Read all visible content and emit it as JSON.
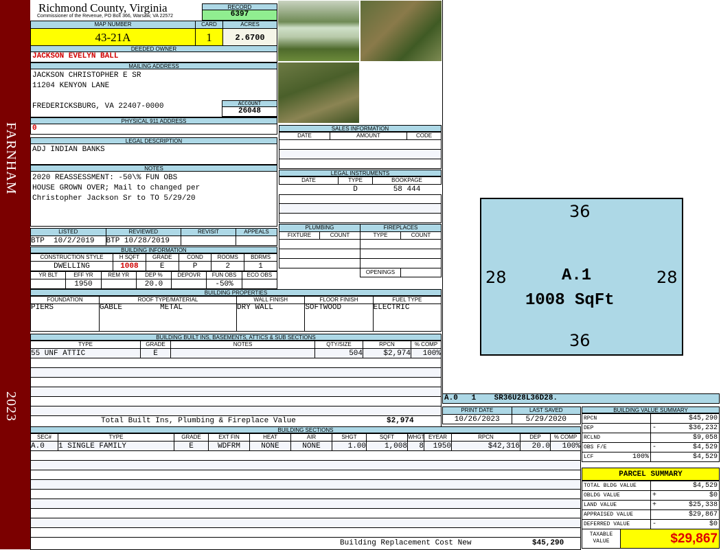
{
  "side": {
    "district": "FARNHAM",
    "year": "2023"
  },
  "header": {
    "county": "Richmond County, Virginia",
    "office": "Commissioner of the Revenue, PO Box 366, Warsaw, VA 22572",
    "record_label": "RECORD",
    "record": "6397"
  },
  "ids": {
    "map_label": "MAP NUMBER",
    "map": "43-21A",
    "card_label": "CARD",
    "card": "1",
    "acres_label": "ACRES",
    "acres": "2.6700"
  },
  "owner": {
    "label": "DEEDED OWNER",
    "name": "JACKSON EVELYN BALL"
  },
  "mailing": {
    "label": "MAILING ADDRESS",
    "line1": "JACKSON CHRISTOPHER E SR",
    "line2": "11204 KENYON LANE",
    "line3": "FREDERICKSBURG, VA 22407-0000",
    "account_label": "ACCOUNT",
    "account": "26048"
  },
  "physical": {
    "label": "PHYSICAL 911 ADDRESS",
    "value": "0"
  },
  "legal": {
    "label": "LEGAL DESCRIPTION",
    "value": "ADJ INDIAN BANKS"
  },
  "notes": {
    "label": "NOTES",
    "line1": "2020 REASSESSMENT: -50\\% FUN OBS",
    "line2": "HOUSE GROWN OVER; Mail to changed per",
    "line3": "Christopher Jackson Sr to TO 5/29/20"
  },
  "review": {
    "listed_label": "LISTED",
    "reviewed_label": "REVIEWED",
    "revisit_label": "REVISIT",
    "appeals_label": "APPEALS",
    "listed_by": "BTP",
    "listed": "10/2/2019",
    "reviewed_by": "BTP",
    "reviewed": "10/28/2019"
  },
  "bldg_info": {
    "label": "BUILDING INFORMATION",
    "h1": [
      "CONSTRUCTION STYLE",
      "H SQFT",
      "GRADE",
      "COND",
      "ROOMS",
      "BDRMS"
    ],
    "v1": [
      "DWELLING",
      "1008",
      "E",
      "P",
      "2",
      "1"
    ],
    "h2": [
      "YR BLT",
      "EFF YR",
      "REM YR",
      "DEP %",
      "DEPOVR",
      "FUN OBS",
      "ECO OBS"
    ],
    "v2": [
      "",
      "1950",
      "",
      "20.0",
      "",
      "-50%",
      ""
    ]
  },
  "sales": {
    "label": "SALES INFORMATION",
    "cols": [
      "DATE",
      "AMOUNT",
      "CODE"
    ]
  },
  "instruments": {
    "label": "LEGAL INSTRUMENTS",
    "cols": [
      "DATE",
      "TYPE",
      "BOOKPAGE"
    ],
    "row": [
      "",
      "D",
      "58 444"
    ]
  },
  "plumbing": {
    "label": "PLUMBING",
    "cols": [
      "FIXTURE",
      "COUNT"
    ]
  },
  "fireplaces": {
    "label": "FIREPLACES",
    "cols": [
      "TYPE",
      "COUNT"
    ],
    "openings": "OPENINGS"
  },
  "props": {
    "label": "BUILDING PROPERTIES",
    "cols": [
      "FOUNDATION",
      "ROOF TYPE/MATERIAL",
      "WALL FINISH",
      "FLOOR FINISH",
      "FUEL TYPE"
    ],
    "foundation": "PIERS",
    "roof_type": "GABLE",
    "roof_material": "METAL",
    "wall": "DRY WALL",
    "floor": "SOFTWOOD",
    "fuel": "ELECTRIC"
  },
  "builtins": {
    "label": "BUILDING BUILT INS, BASEMENTS, ATTICS & SUB SECTIONS",
    "cols": [
      "TYPE",
      "GRADE",
      "NOTES",
      "QTY/SIZE",
      "RPCN",
      "% COMP"
    ],
    "row": [
      "55 UNF ATTIC",
      "E",
      "",
      "504",
      "$2,974",
      "100%"
    ],
    "total_label": "Total Built Ins, Plumbing & Fireplace Value",
    "total": "$2,974"
  },
  "sketch": {
    "top": "36",
    "left": "28",
    "right": "28",
    "bottom": "36",
    "code": "A.1",
    "area": "1008 SqFt",
    "line": "A.0   1    SR36U28L36D28."
  },
  "dates": {
    "print_label": "PRINT DATE",
    "print": "10/26/2023",
    "saved_label": "LAST SAVED",
    "saved": "5/29/2020"
  },
  "sections": {
    "label": "BUILDING SECTIONS",
    "cols": [
      "SEC#",
      "TYPE",
      "GRADE",
      "EXT FIN",
      "HEAT",
      "AIR",
      "SHGT",
      "SQFT",
      "WHGT",
      "EYEAR",
      "RPCN",
      "DEP",
      "% COMP"
    ],
    "row": [
      "A.0",
      "1 SINGLE FAMILY",
      "E",
      "WDFRM",
      "NONE",
      "NONE",
      "1.00",
      "1,008",
      "8",
      "1950",
      "$42,316",
      "20.0",
      "100%"
    ],
    "total_label": "Building Replacement Cost New",
    "total": "$45,290"
  },
  "value_summary": {
    "label": "BUILDING VALUE SUMMARY",
    "rows": [
      {
        "k": "RPCN",
        "s": "",
        "v": "$45,290"
      },
      {
        "k": "DEP",
        "s": "-",
        "v": "$36,232"
      },
      {
        "k": "RCLND",
        "s": "",
        "v": "$9,058"
      },
      {
        "k": "OBS F/E",
        "s": "-",
        "v": "$4,529"
      },
      {
        "k": "LCF",
        "p": "100%",
        "s": "",
        "v": "$4,529"
      }
    ]
  },
  "parcel": {
    "label": "PARCEL SUMMARY",
    "rows": [
      {
        "k": "TOTAL BLDG VALUE",
        "s": "",
        "v": "$4,529"
      },
      {
        "k": "OBLDG VALUE",
        "s": "+",
        "v": "$0"
      },
      {
        "k": "LAND VALUE",
        "s": "+",
        "v": "$25,338"
      },
      {
        "k": "APPRAISED VALUE",
        "s": "",
        "v": "$29,867"
      },
      {
        "k": "DEFERRED VALUE",
        "s": "-",
        "v": "$0"
      }
    ],
    "taxable_label": "TAXABLE VALUE",
    "taxable": "$29,867"
  },
  "colors": {
    "header": "#add8e6",
    "highlight": "#ffff00",
    "record": "#90ee90",
    "side": "#7b0000",
    "alert": "#d00000"
  }
}
